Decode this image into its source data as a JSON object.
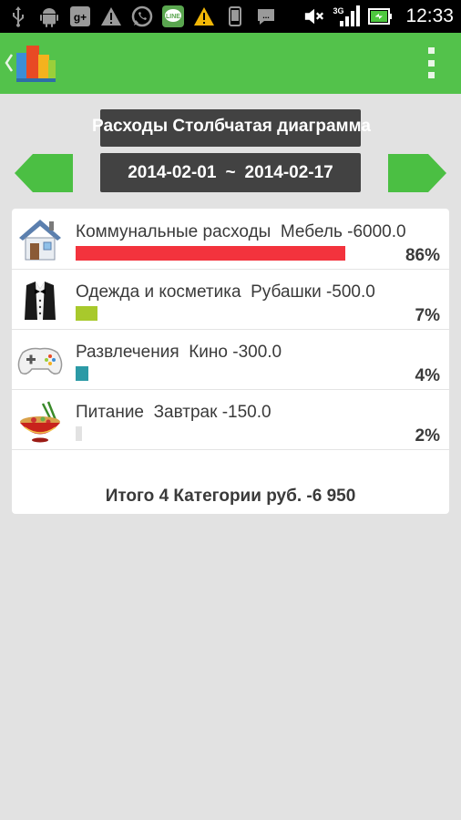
{
  "status_bar": {
    "time": "12:33",
    "network_type": "3G",
    "icons_left": [
      "usb-icon",
      "android-icon",
      "google-plus-icon",
      "warning-icon",
      "whatsapp-icon",
      "line-icon",
      "warning-yellow-icon",
      "phone-icon",
      "chat-icon"
    ],
    "icons_right": [
      "mute-icon",
      "signal-icon",
      "battery-icon"
    ]
  },
  "colors": {
    "accent": "#53c24b",
    "dark_box": "#424242",
    "bar_row1": "#f3333d",
    "bar_row2": "#a8c92c",
    "bar_row3": "#2c9aa6",
    "bar_row4": "#e2e2e2"
  },
  "screen": {
    "title": "Расходы Столбчатая диаграмма",
    "date_from": "2014-02-01",
    "date_sep": "~",
    "date_to": "2014-02-17"
  },
  "rows": [
    {
      "category": "Коммунальные расходы",
      "item": "Мебель",
      "amount": "-6000.0",
      "percent": "86%",
      "share": 0.86,
      "icon": "house-icon"
    },
    {
      "category": "Одежда и косметика",
      "item": "Рубашки",
      "amount": "-500.0",
      "percent": "7%",
      "share": 0.07,
      "icon": "tuxedo-icon"
    },
    {
      "category": "Развлечения",
      "item": "Кино",
      "amount": "-300.0",
      "percent": "4%",
      "share": 0.04,
      "icon": "gamepad-icon"
    },
    {
      "category": "Питание",
      "item": "Завтрак",
      "amount": "-150.0",
      "percent": "2%",
      "share": 0.02,
      "icon": "food-bowl-icon"
    }
  ],
  "total": {
    "text": "Итого 4 Категории руб. -6 950"
  }
}
